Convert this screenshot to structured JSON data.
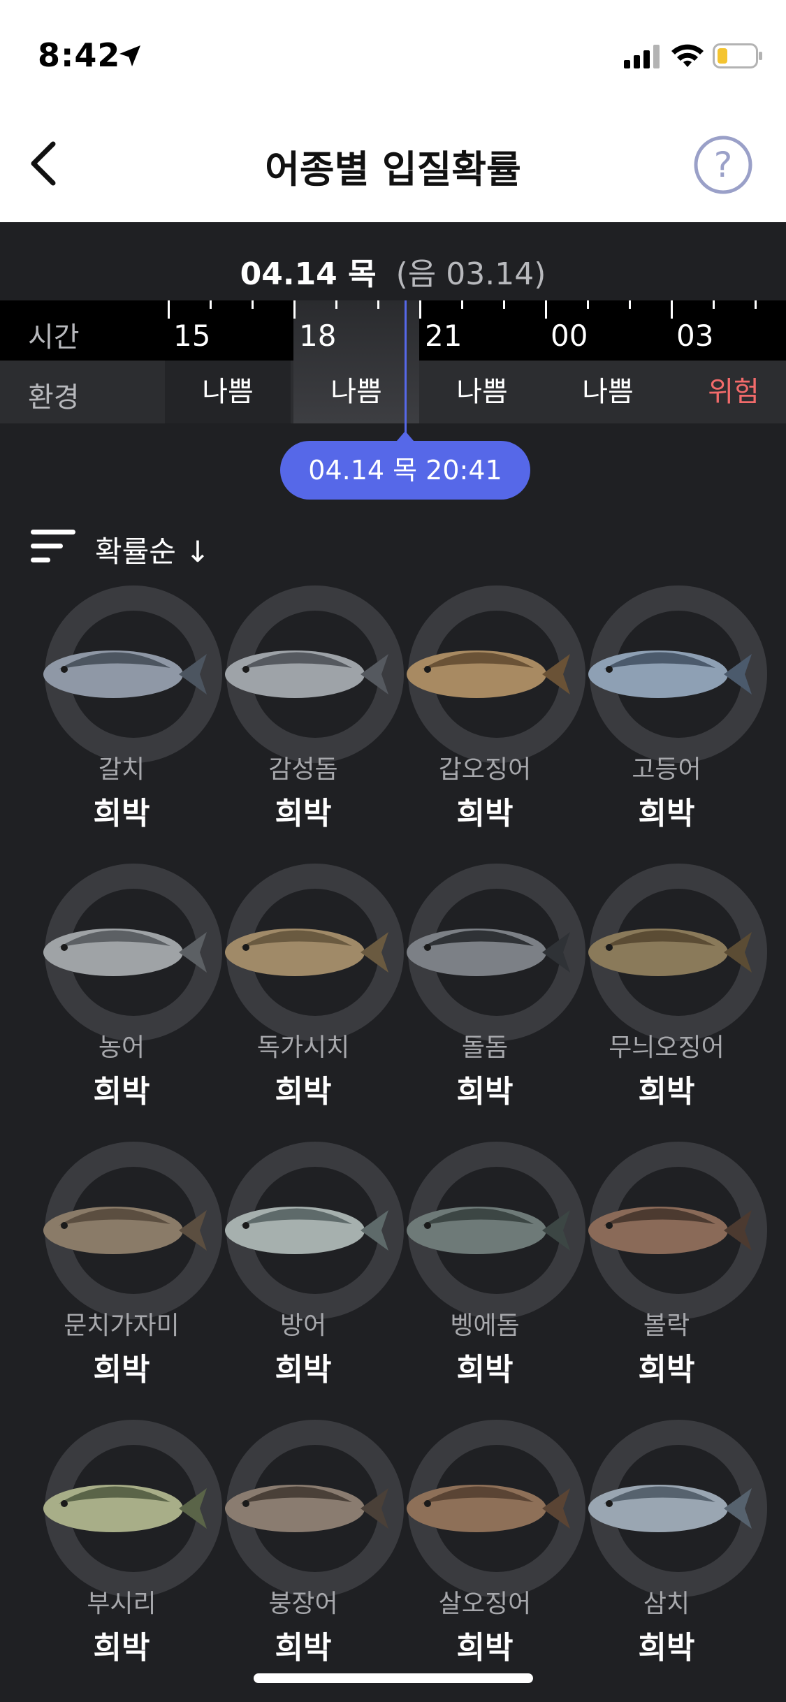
{
  "status_bar": {
    "time": "8:42",
    "battery_color": "#f4c430"
  },
  "nav": {
    "title": "어종별 입질확률",
    "back_icon": "chevron-left-icon",
    "help_icon": "question-circle-icon"
  },
  "date_header": {
    "date": "04.14 목",
    "lunar": "(음 03.14)"
  },
  "timeline": {
    "time_label": "시간",
    "env_label": "환경",
    "hours": [
      "15",
      "18",
      "21",
      "00",
      "03"
    ],
    "conditions": [
      "나쁨",
      "나쁨",
      "나쁨",
      "나쁨",
      "위험"
    ],
    "condition_colors": [
      "#ffffff",
      "#ffffff",
      "#ffffff",
      "#ffffff",
      "#f26b6b"
    ],
    "selected_label": "04.14 목 20:41",
    "accent_color": "#5668e8"
  },
  "sort": {
    "label": "확률순 ↓"
  },
  "fish": [
    {
      "name": "갈치",
      "prob": "희박"
    },
    {
      "name": "감성돔",
      "prob": "희박"
    },
    {
      "name": "갑오징어",
      "prob": "희박"
    },
    {
      "name": "고등어",
      "prob": "희박"
    },
    {
      "name": "농어",
      "prob": "희박"
    },
    {
      "name": "독가시치",
      "prob": "희박"
    },
    {
      "name": "돌돔",
      "prob": "희박"
    },
    {
      "name": "무늬오징어",
      "prob": "희박"
    },
    {
      "name": "문치가자미",
      "prob": "희박"
    },
    {
      "name": "방어",
      "prob": "희박"
    },
    {
      "name": "벵에돔",
      "prob": "희박"
    },
    {
      "name": "볼락",
      "prob": "희박"
    },
    {
      "name": "부시리",
      "prob": "희박"
    },
    {
      "name": "붕장어",
      "prob": "희박"
    },
    {
      "name": "살오징어",
      "prob": "희박"
    },
    {
      "name": "삼치",
      "prob": "희박"
    }
  ]
}
